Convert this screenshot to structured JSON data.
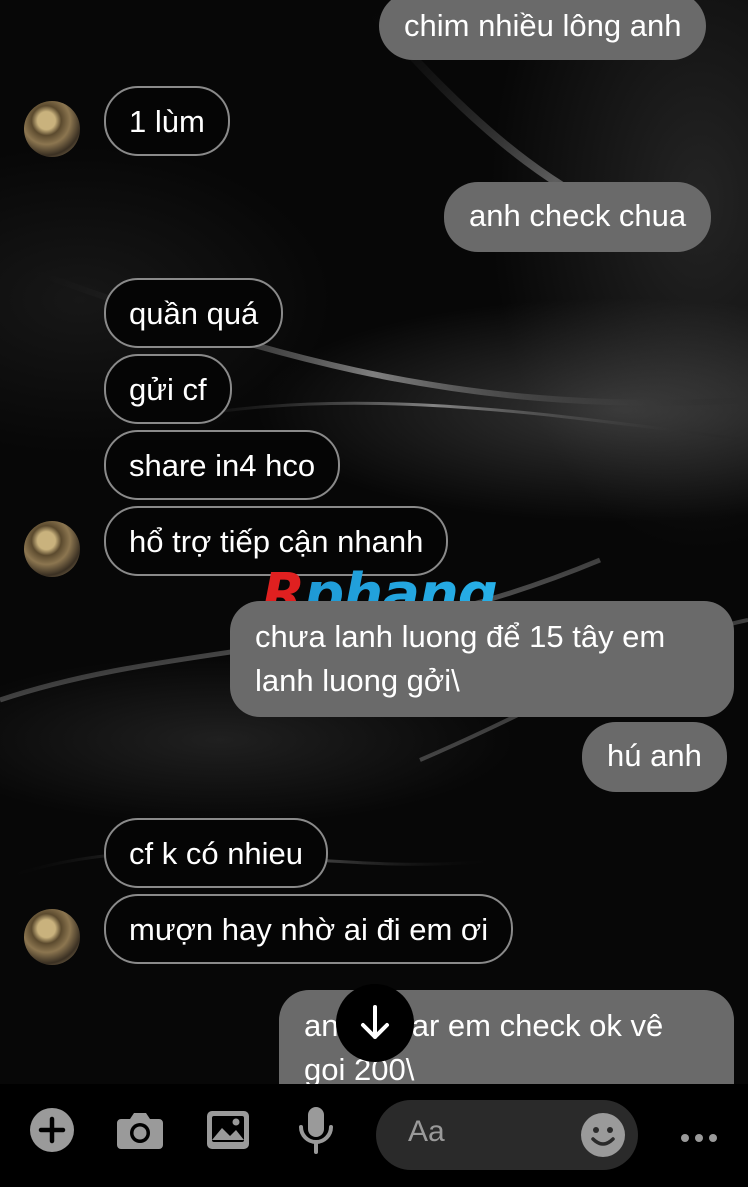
{
  "messages": [
    {
      "from": "me",
      "text": "chim nhiều lông anh"
    },
    {
      "from": "them",
      "text": "1 lùm"
    },
    {
      "from": "me",
      "text": "anh check chua"
    },
    {
      "from": "them",
      "text": "quần quá"
    },
    {
      "from": "them",
      "text": "gửi cf"
    },
    {
      "from": "them",
      "text": "share in4 hco"
    },
    {
      "from": "them",
      "text": "hổ trợ tiếp cận nhanh"
    },
    {
      "from": "me",
      "text": "chưa lanh luong để 15 tây em lanh luong gởi\\"
    },
    {
      "from": "me",
      "text": "hú anh"
    },
    {
      "from": "them",
      "text": "cf k có nhieu"
    },
    {
      "from": "them",
      "text": "mượn hay nhờ ai đi em ơi"
    },
    {
      "from": "me",
      "text_start": "an",
      "text_rest": "ear em check ok vê",
      "text_line2": "goi 200\\"
    }
  ],
  "watermark": "Rphang",
  "composer": {
    "placeholder": "Aa",
    "icons": [
      "plus-icon",
      "camera-icon",
      "image-icon",
      "microphone-icon",
      "emoji-icon",
      "more-icon"
    ]
  },
  "colors": {
    "outgoing_bubble": "#6a6a6a",
    "incoming_border": "#8a8a8a",
    "background": "#050505"
  }
}
